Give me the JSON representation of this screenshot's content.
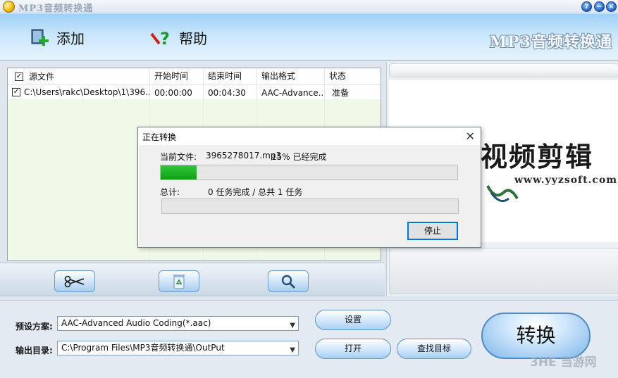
{
  "window": {
    "title": "MP3音频转换通",
    "help_btn": "?",
    "min_btn": "−",
    "close_btn": "×"
  },
  "toolbar": {
    "add_label": "添加",
    "help_label": "帮助",
    "brand": "MP3音频转换通"
  },
  "file_list": {
    "columns": [
      "源文件",
      "开始时间",
      "结束时间",
      "输出格式",
      "状态"
    ],
    "rows": [
      {
        "source": "C:\\Users\\rakc\\Desktop\\1\\396...",
        "start": "00:00:00",
        "end": "00:04:30",
        "format": "AAC-Advance...",
        "status": "准备",
        "checked": true
      }
    ]
  },
  "preview": {
    "logo_title": "视频剪辑",
    "logo_url": "www.yyzsoft.com"
  },
  "actions": {
    "icons": [
      "scissors-icon",
      "recycle-icon",
      "magnifier-icon"
    ]
  },
  "settings": {
    "preset_label": "预设方案:",
    "preset_value": "AAC-Advanced Audio Coding(*.aac)",
    "output_label": "输出目录:",
    "output_value": "C:\\Program Files\\MP3音频转换通\\OutPut",
    "settings_btn": "设置",
    "open_btn": "打开",
    "find_btn": "查找目标",
    "convert_btn": "转换"
  },
  "dialog": {
    "title": "正在转换",
    "close": "✕",
    "current_label": "当前文件:",
    "current_file": "3965278017.mp3",
    "current_status": "15% 已经完成",
    "current_progress": 0.12,
    "total_label": "总计:",
    "total_status": "0 任务完成 / 总共 1 任务",
    "total_progress": 0,
    "stop_btn": "停止"
  },
  "watermark": "3HE 当游网",
  "colors": {
    "progress_green": "#0aa314",
    "accent_blue": "#0078d7"
  }
}
